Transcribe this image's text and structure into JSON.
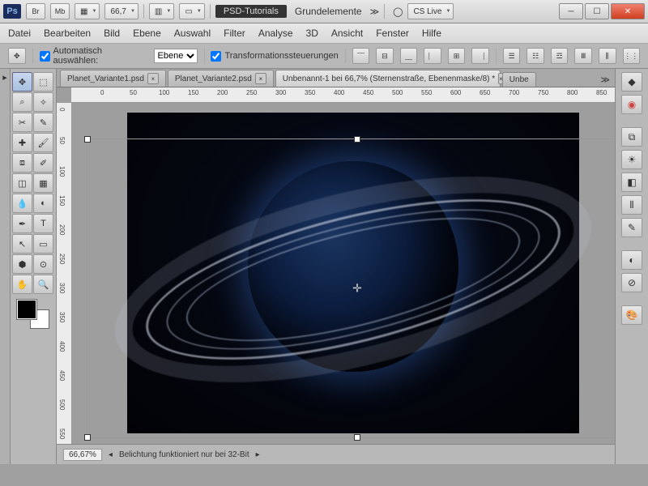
{
  "titlebar": {
    "app": "Ps",
    "br": "Br",
    "mb": "Mb",
    "zoom": "66,7",
    "psd_tut": "PSD-Tutorials",
    "grund": "Grundelemente",
    "cslive": "CS Live"
  },
  "menu": {
    "datei": "Datei",
    "bearbeiten": "Bearbeiten",
    "bild": "Bild",
    "ebene": "Ebene",
    "auswahl": "Auswahl",
    "filter": "Filter",
    "analyse": "Analyse",
    "dd": "3D",
    "ansicht": "Ansicht",
    "fenster": "Fenster",
    "hilfe": "Hilfe"
  },
  "opt": {
    "auto": "Automatisch auswählen:",
    "ebene": "Ebene",
    "trans": "Transformationssteuerungen"
  },
  "tabs": {
    "t1": "Planet_Variante1.psd",
    "t2": "Planet_Variante2.psd",
    "t3": "Unbenannt-1 bei 66,7% (Sternenstraße, Ebenenmaske/8) *",
    "t4": "Unbe"
  },
  "status": {
    "zoom": "66,67%",
    "msg": "Belichtung funktioniert nur bei 32-Bit"
  }
}
